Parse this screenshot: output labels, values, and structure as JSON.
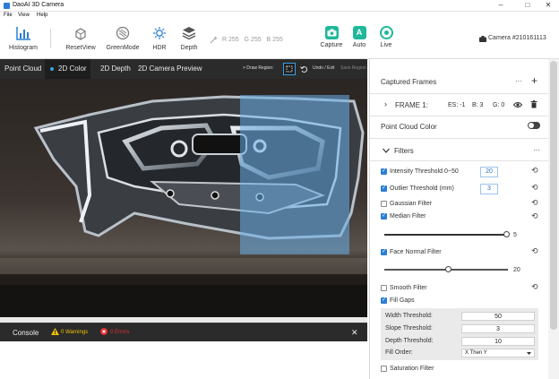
{
  "window": {
    "title": "DaoAI 3D Camera",
    "controls": [
      "–",
      "□",
      "✕"
    ]
  },
  "menu": [
    "File",
    "View",
    "Help"
  ],
  "toolbar": {
    "histogram": "Histogram",
    "reset_view": "ResetView",
    "green_mode": "GreenMode",
    "hdr": "HDR",
    "depth": "Depth",
    "rgb": {
      "r_label": "R",
      "r": "255",
      "g_label": "G",
      "g": "255",
      "b_label": "B",
      "b": "255"
    },
    "capture": "Capture",
    "auto": "Auto",
    "auto_glyph": "A",
    "live": "Live",
    "camera": "Camera #210161113"
  },
  "view_tabs": [
    "Point Cloud",
    "2D Color",
    "2D Depth",
    "2D Camera Preview"
  ],
  "view_tools": {
    "draw_region": "> Draw Region:",
    "undo_exit": "Undo / Exit",
    "save_region": "Save Region"
  },
  "console": {
    "title": "Console",
    "warnings": "0 Warnings",
    "errors": "0 Errors",
    "close": "✕"
  },
  "panel": {
    "captured_frames": "Captured Frames",
    "more": "···",
    "add": "+",
    "frame": {
      "chevron": "›",
      "label": "FRAME 1:",
      "es": "ES: -1",
      "b": "B: 3",
      "g": "G: 0"
    },
    "point_cloud_color": "Point Cloud Color",
    "filters_title": "Filters",
    "filters": {
      "intensity": {
        "label": "Intensity Threshold  0~50",
        "value": "20",
        "checked": true
      },
      "outlier": {
        "label": "Outlier Threshold (mm)",
        "value": "3",
        "checked": true
      },
      "gaussian": {
        "label": "Gaussian Filter",
        "checked": false
      },
      "median": {
        "label": "Median Filter",
        "checked": true,
        "slider_value": "5",
        "slider_fraction": 0.98
      },
      "face_normal": {
        "label": "Face Normal Filter",
        "checked": true,
        "slider_value": "20",
        "slider_fraction": 0.5
      },
      "smooth": {
        "label": "Smooth Filter",
        "checked": false
      },
      "fill_gaps": {
        "label": "Fill Gaps",
        "checked": true,
        "width_label": "Width Threshold:",
        "width_value": "50",
        "slope_label": "Slope Threshold:",
        "slope_value": "3",
        "depth_label": "Depth Threshold:",
        "depth_value": "10",
        "order_label": "Fill Order:",
        "order_value": "X Then Y"
      },
      "saturation": {
        "label": "Saturation Filter",
        "checked": false
      }
    }
  },
  "colors": {
    "accent": "#2a7fd4",
    "green": "#1fb89a",
    "tab_bg": "#2b2b2b",
    "warn": "#f2c200",
    "error": "#e03030"
  }
}
